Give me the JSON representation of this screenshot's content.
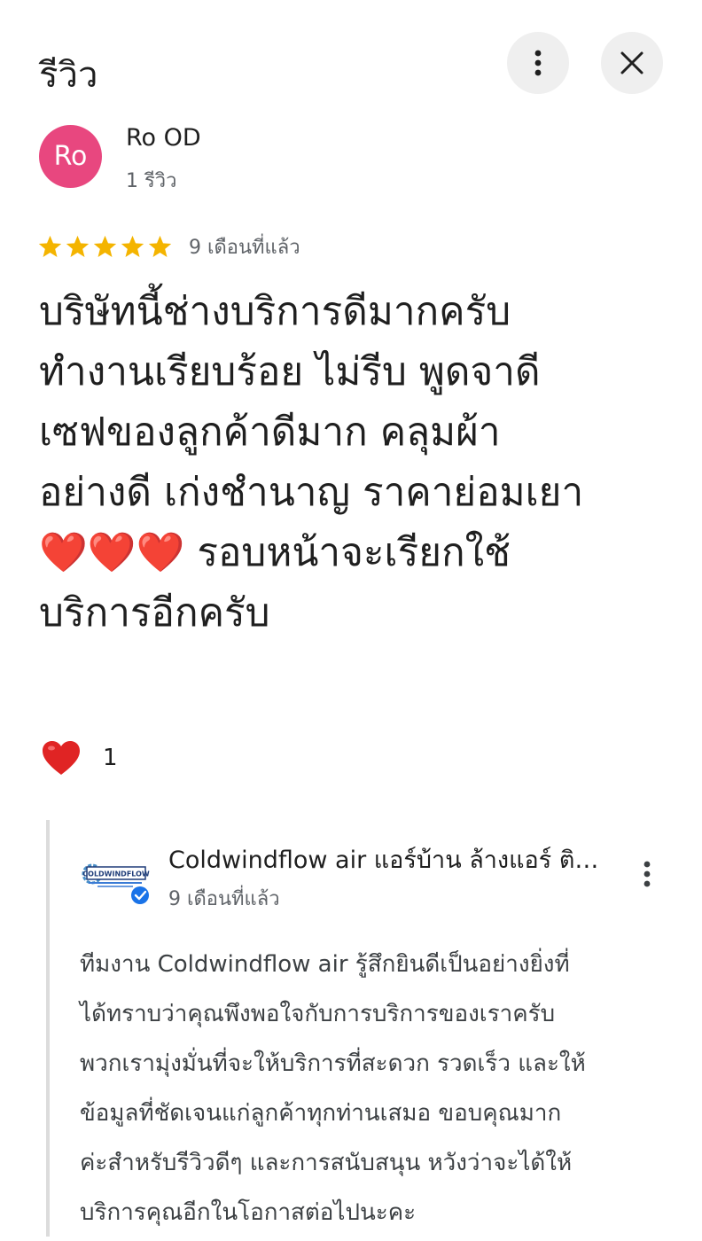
{
  "header": {
    "title": "รีวิว",
    "more_icon": "more-vertical-icon",
    "close_icon": "close-icon"
  },
  "review": {
    "avatar_initials": "Ro",
    "avatar_color": "#e8477f",
    "author_name": "Ro OD",
    "author_subtitle": "1 รีวิว",
    "rating": 5,
    "rating_max": 5,
    "star_color": "#f4b400",
    "time_ago": "9 เดือนที่แล้ว",
    "text": "บริษัทนี้ช่างบริการดีมากครับ\nทำงานเรียบร้อย ไม่รีบ พูดจาดี\nเซฟของลูกค้าดีมาก คลุมผ้า\nอย่างดี เก่งชำนาญ ราคาย่อมเยา\n❤️❤️❤️ รอบหน้าจะเรียกใช้\nบริการอีกครับ",
    "reaction_icon": "heart-icon",
    "reaction_count": "1"
  },
  "owner_reply": {
    "logo_text": "COLDWINDFLOW",
    "verified_icon": "verified-check-icon",
    "name": "Coldwindflow air แอร์บ้าน ล้างแอร์ ติดตั้งแอร์",
    "time_ago": "9 เดือนที่แล้ว",
    "more_icon": "more-vertical-icon",
    "text": "ทีมงาน Coldwindflow air รู้สึกยินดีเป็นอย่างยิ่งที่\nได้ทราบว่าคุณพึงพอใจกับการบริการของเราครับ\nพวกเรามุ่งมั่นที่จะให้บริการที่สะดวก รวดเร็ว และให้\nข้อมูลที่ชัดเจนแก่ลูกค้าทุกท่านเสมอ ขอบคุณมาก\nค่ะสำหรับรีวิวดีๆ และการสนับสนุน หวังว่าจะได้ให้\nบริการคุณอีกในโอกาสต่อไปนะคะ"
  }
}
